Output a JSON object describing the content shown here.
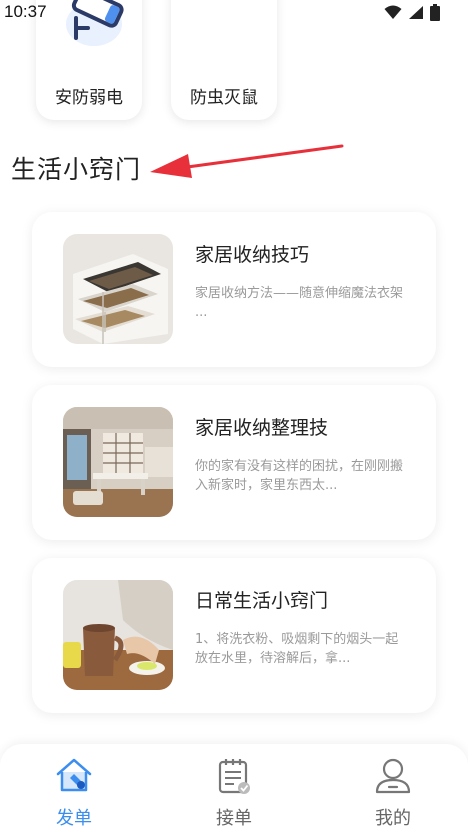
{
  "status_bar": {
    "time": "10:37"
  },
  "categories": [
    {
      "label": "安防弱电",
      "icon": "security-camera-icon"
    },
    {
      "label": "防虫灭鼠",
      "icon": "pest-control-icon"
    }
  ],
  "section": {
    "title": "生活小窍门"
  },
  "tips": [
    {
      "title": "家居收纳技巧",
      "desc": "家居收纳方法——随意伸缩魔法衣架 ...",
      "thumb": "drawer-photo"
    },
    {
      "title": "家居收纳整理技",
      "desc": "你的家有没有这样的困扰，在刚刚搬入新家时，家里东西太...",
      "thumb": "room-photo"
    },
    {
      "title": "日常生活小窍门",
      "desc": "1、将洗衣粉、吸烟剩下的烟头一起放在水里，待溶解后，拿...",
      "thumb": "mug-photo"
    }
  ],
  "nav": [
    {
      "label": "发单",
      "icon": "home-order-icon",
      "active": true
    },
    {
      "label": "接单",
      "icon": "clipboard-check-icon",
      "active": false
    },
    {
      "label": "我的",
      "icon": "user-profile-icon",
      "active": false
    }
  ],
  "colors": {
    "accent": "#3b8ef0",
    "arrow": "#e8303a"
  }
}
